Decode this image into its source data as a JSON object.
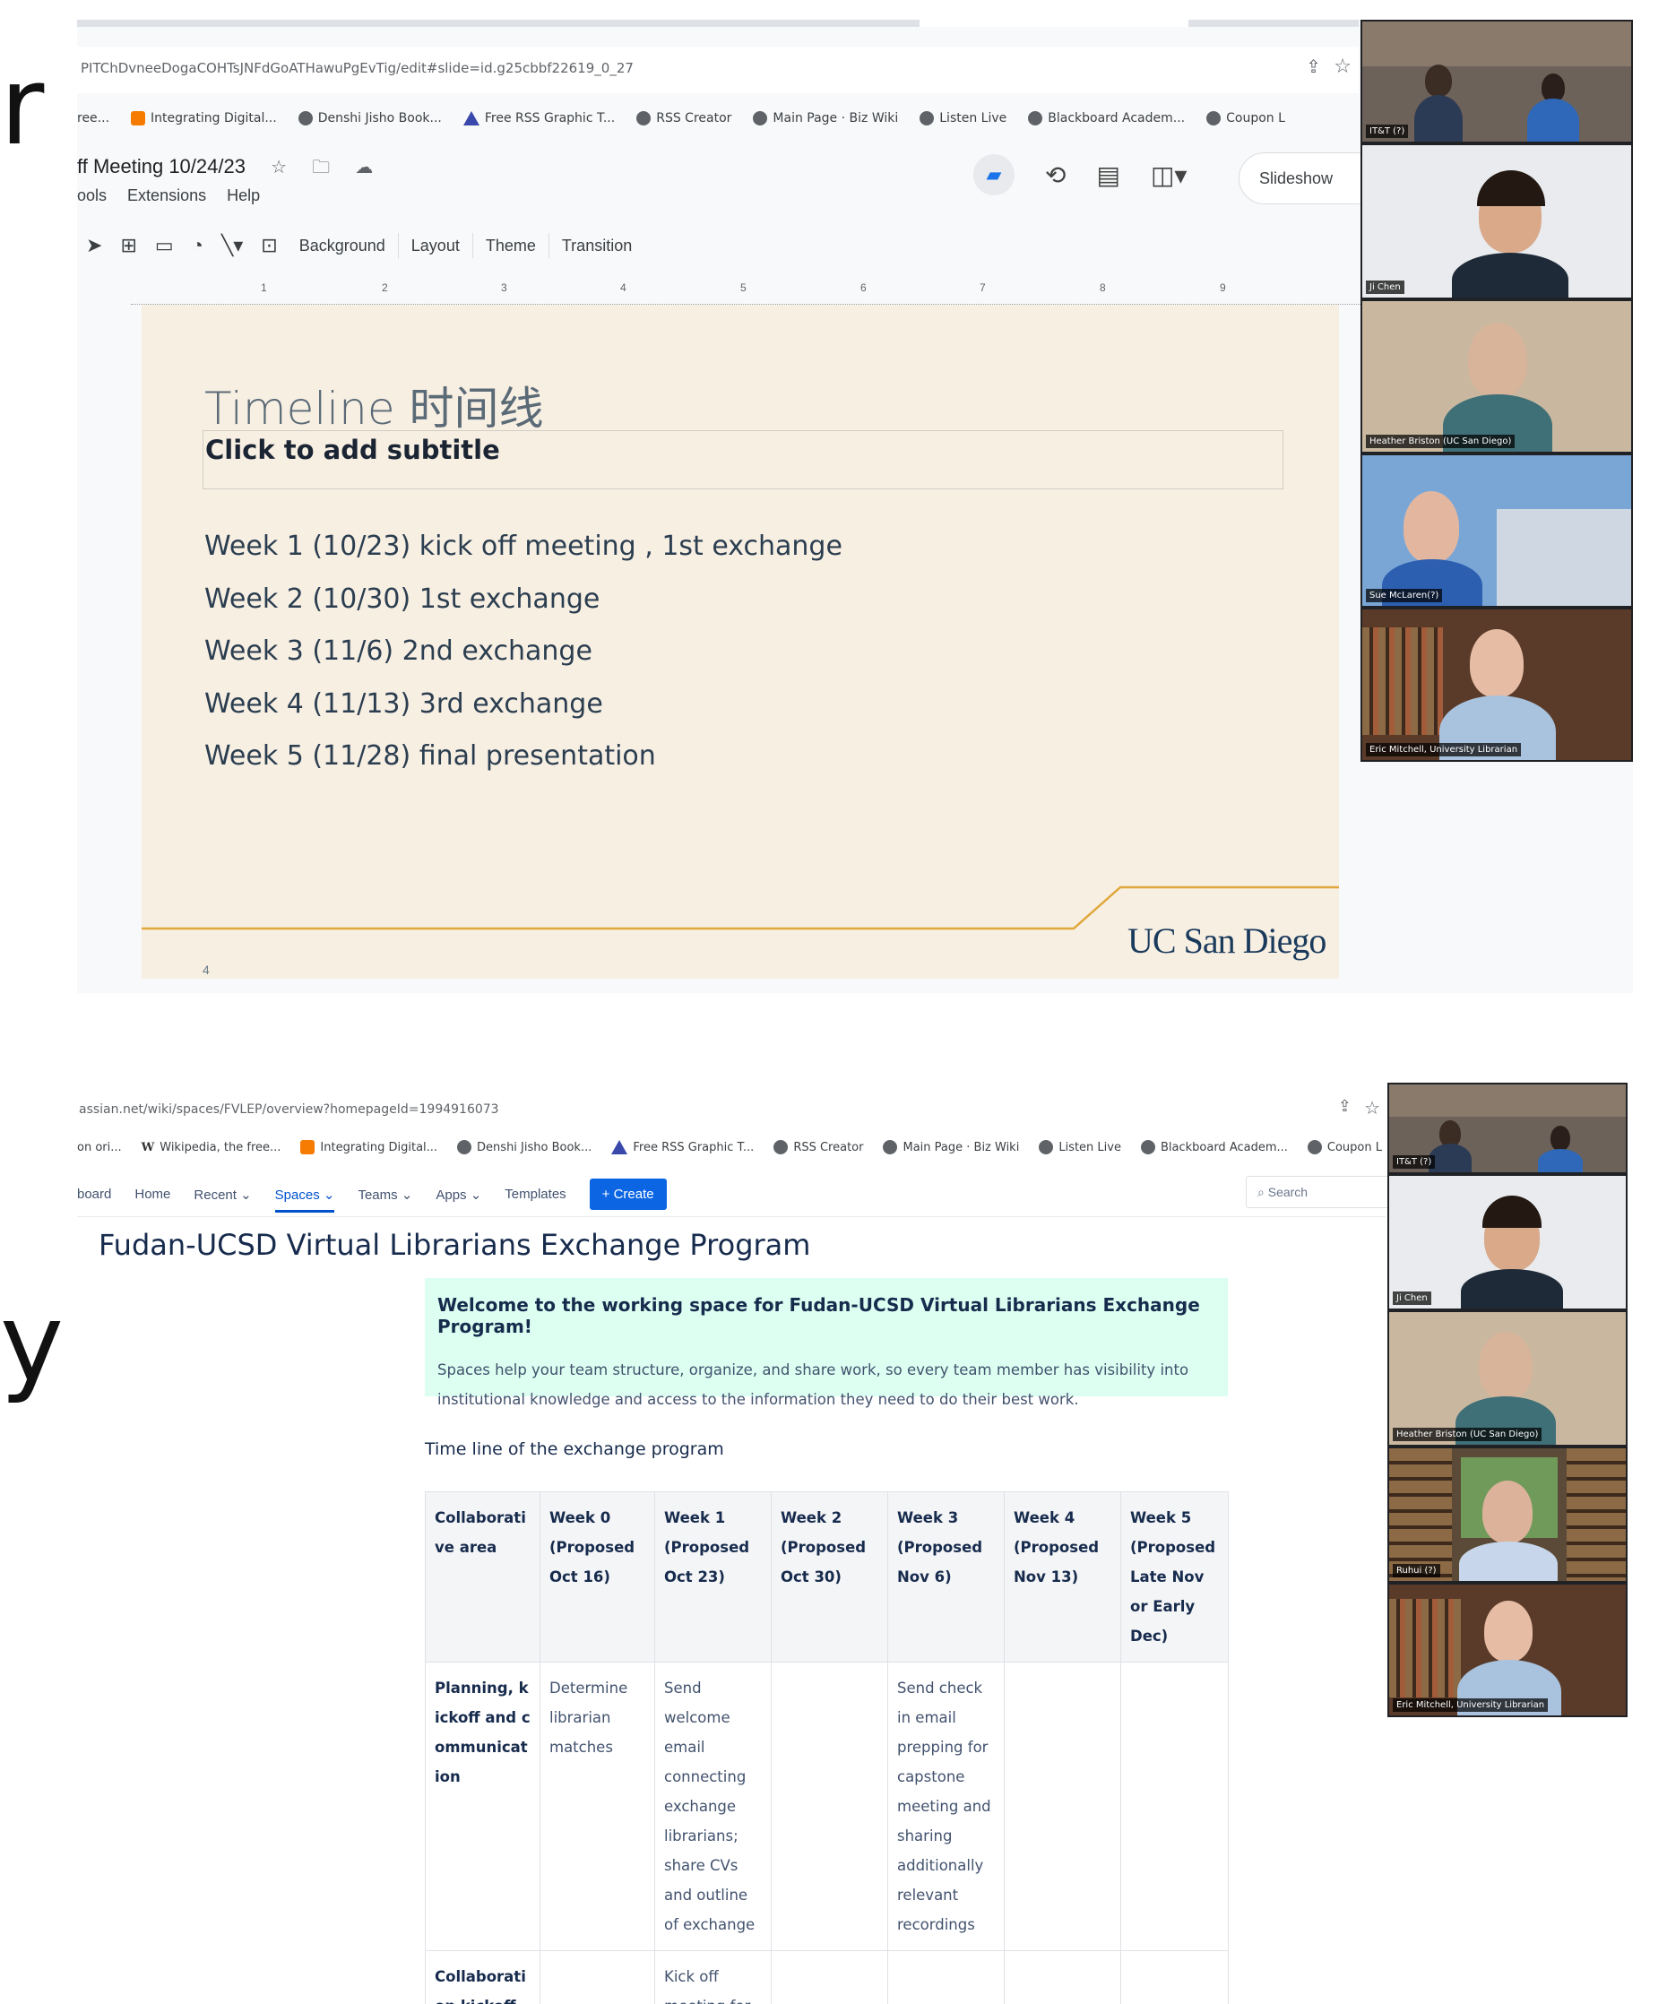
{
  "slides_window": {
    "url": "PITChDvneeDogaCOHTsJNFdGoATHawuPgEvTig/edit#slide=id.g25cbbf22619_0_27",
    "bookmarks": [
      {
        "icon": "orange-square-icon",
        "label": "Integrating Digital..."
      },
      {
        "icon": "globe-icon",
        "label": "Denshi Jisho Book..."
      },
      {
        "icon": "triangle-logo-icon",
        "label": "Free RSS Graphic T..."
      },
      {
        "icon": "globe-icon",
        "label": "RSS Creator"
      },
      {
        "icon": "globe-icon",
        "label": "Main Page · Biz Wiki"
      },
      {
        "icon": "globe-icon",
        "label": "Listen Live"
      },
      {
        "icon": "globe-icon",
        "label": "Blackboard Academ..."
      },
      {
        "icon": "globe-icon",
        "label": "Coupon L"
      }
    ],
    "bookmark_lead": "ree...",
    "doc_title": "ff Meeting 10/24/23",
    "menus": [
      "ools",
      "Extensions",
      "Help"
    ],
    "slideshow_label": "Slideshow",
    "toolbar": {
      "background": "Background",
      "layout": "Layout",
      "theme": "Theme",
      "transition": "Transition"
    },
    "ruler": [
      "1",
      "2",
      "3",
      "4",
      "5",
      "6",
      "7",
      "8",
      "9"
    ],
    "slide": {
      "title": "Timeline 时间线",
      "subtitle": "Click to add subtitle",
      "items": [
        "Week 1 (10/23) kick off meeting , 1st exchange",
        "Week 2 (10/30) 1st exchange",
        "Week 3 (11/6) 2nd exchange",
        "Week 4 (11/13) 3rd exchange",
        "Week 5 (11/28) final presentation"
      ],
      "logo": "UC San Diego",
      "number": "4"
    },
    "participants": [
      "IT&T (?)",
      "Ji Chen",
      "Heather Briston (UC San Diego)",
      "Sue McLaren(?)",
      "Eric Mitchell, University Librarian"
    ]
  },
  "confluence_window": {
    "url": "assian.net/wiki/spaces/FVLEP/overview?homepageId=1994916073",
    "bookmarks": [
      {
        "icon": "",
        "label": "on ori..."
      },
      {
        "icon": "wikipedia-icon",
        "label": "Wikipedia, the free..."
      },
      {
        "icon": "orange-square-icon",
        "label": "Integrating Digital..."
      },
      {
        "icon": "globe-icon",
        "label": "Denshi Jisho Book..."
      },
      {
        "icon": "triangle-logo-icon",
        "label": "Free RSS Graphic T..."
      },
      {
        "icon": "globe-icon",
        "label": "RSS Creator"
      },
      {
        "icon": "globe-icon",
        "label": "Main Page · Biz Wiki"
      },
      {
        "icon": "globe-icon",
        "label": "Listen Live"
      },
      {
        "icon": "globe-icon",
        "label": "Blackboard Academ..."
      },
      {
        "icon": "globe-icon",
        "label": "Coupon L"
      }
    ],
    "nav": [
      "board",
      "Home",
      "Recent ⌄",
      "Spaces ⌄",
      "Teams ⌄",
      "Apps ⌄",
      "Templates"
    ],
    "create_label": "+  Create",
    "search_placeholder": "Search",
    "space_title": "Fudan-UCSD Virtual Librarians Exchange Program",
    "panel_heading": "Welcome to the working space for Fudan-UCSD Virtual Librarians Exchange Program!",
    "panel_text": "Spaces help your team structure, organize, and share work, so every team member has visibility into institutional knowledge and access to the information they need to do their best work.",
    "timeline_heading": "Time line of the exchange program",
    "table": {
      "headers": [
        "Collaborative area",
        "Week 0 (Proposed Oct 16)",
        "Week 1 (Proposed Oct 23)",
        "Week 2 (Proposed Oct 30)",
        "Week 3 (Proposed Nov 6)",
        "Week 4 (Proposed Nov 13)",
        "Week 5 (Proposed Late Nov or Early Dec)"
      ],
      "rows": [
        [
          "Planning, kickoff and communication",
          "Determine librarian matches",
          "Send welcome email connecting exchange librarians; share CVs and outline of exchange",
          "",
          "Send check in email prepping for capstone meeting and sharing additionally relevant recordings",
          "",
          ""
        ],
        [
          "Collaboration kickoff",
          "",
          "Kick off meeting for participating",
          "",
          "",
          "",
          ""
        ]
      ]
    },
    "participants": [
      "IT&T (?)",
      "Ji Chen",
      "Heather Briston (UC San Diego)",
      "Ruhui (?)",
      "Eric Mitchell, University Librarian"
    ]
  },
  "deck_letters": {
    "top": "r",
    "bottom": "y"
  },
  "colors": {
    "slide_bg": "#f8efe3",
    "gold": "#e0a83a",
    "ucsd_navy": "#1a3a5c",
    "confluence_blue": "#0c66e4",
    "panel_green": "#dcfff1"
  }
}
